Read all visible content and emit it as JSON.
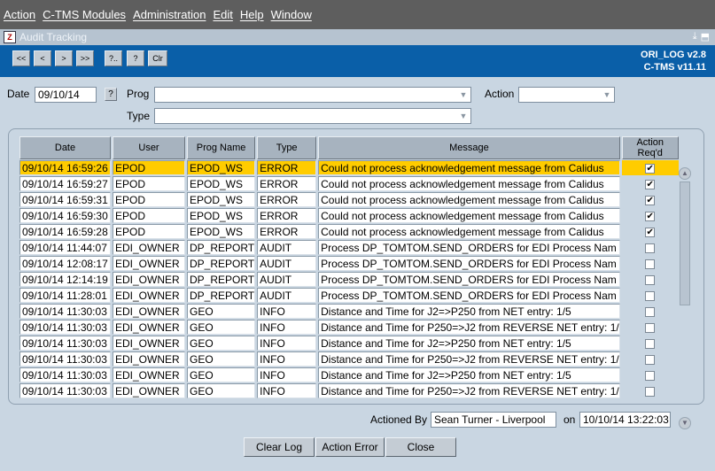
{
  "menu": [
    "Action",
    "C-TMS Modules",
    "Administration",
    "Edit",
    "Help",
    "Window"
  ],
  "window": {
    "title": "Audit Tracking",
    "controls": [
      "⤓",
      "⬒"
    ],
    "app_icon": "Z"
  },
  "toolbar": {
    "buttons": [
      "<<",
      "<",
      ">",
      ">>",
      "?..",
      "?",
      "Clr"
    ],
    "version1": "ORI_LOG v2.8",
    "version2": "C-TMS v11.11"
  },
  "filters": {
    "date_label": "Date",
    "date_value": "09/10/14",
    "help_btn": "?",
    "prog_label": "Prog",
    "prog_value": "",
    "action_label": "Action",
    "action_value": "",
    "type_label": "Type",
    "type_value": ""
  },
  "grid": {
    "columns": [
      "Date",
      "User",
      "Prog Name",
      "Type",
      "Message",
      "Action Req'd"
    ],
    "rows": [
      {
        "date": "09/10/14 16:59:26",
        "user": "EPOD",
        "prog": "EPOD_WS",
        "type": "ERROR",
        "message": "Could not process acknowledgement message from Calidus",
        "checked": true,
        "selected": true
      },
      {
        "date": "09/10/14 16:59:27",
        "user": "EPOD",
        "prog": "EPOD_WS",
        "type": "ERROR",
        "message": "Could not process acknowledgement message from Calidus",
        "checked": true
      },
      {
        "date": "09/10/14 16:59:31",
        "user": "EPOD",
        "prog": "EPOD_WS",
        "type": "ERROR",
        "message": "Could not process acknowledgement message from Calidus",
        "checked": true
      },
      {
        "date": "09/10/14 16:59:30",
        "user": "EPOD",
        "prog": "EPOD_WS",
        "type": "ERROR",
        "message": "Could not process acknowledgement message from Calidus",
        "checked": true
      },
      {
        "date": "09/10/14 16:59:28",
        "user": "EPOD",
        "prog": "EPOD_WS",
        "type": "ERROR",
        "message": "Could not process acknowledgement message from Calidus",
        "checked": true
      },
      {
        "date": "09/10/14 11:44:07",
        "user": "EDI_OWNER",
        "prog": "DP_REPORT",
        "type": "AUDIT",
        "message": "Process DP_TOMTOM.SEND_ORDERS for EDI Process Nam",
        "checked": false
      },
      {
        "date": "09/10/14 12:08:17",
        "user": "EDI_OWNER",
        "prog": "DP_REPORT",
        "type": "AUDIT",
        "message": "Process DP_TOMTOM.SEND_ORDERS for EDI Process Nam",
        "checked": false
      },
      {
        "date": "09/10/14 12:14:19",
        "user": "EDI_OWNER",
        "prog": "DP_REPORT",
        "type": "AUDIT",
        "message": "Process DP_TOMTOM.SEND_ORDERS for EDI Process Nam",
        "checked": false
      },
      {
        "date": "09/10/14 11:28:01",
        "user": "EDI_OWNER",
        "prog": "DP_REPORT",
        "type": "AUDIT",
        "message": "Process DP_TOMTOM.SEND_ORDERS for EDI Process Nam",
        "checked": false
      },
      {
        "date": "09/10/14 11:30:03",
        "user": "EDI_OWNER",
        "prog": "GEO",
        "type": "INFO",
        "message": "Distance and Time for J2=>P250 from NET entry: 1/5",
        "checked": false
      },
      {
        "date": "09/10/14 11:30:03",
        "user": "EDI_OWNER",
        "prog": "GEO",
        "type": "INFO",
        "message": "Distance and Time for P250=>J2 from REVERSE NET entry: 1/",
        "checked": false
      },
      {
        "date": "09/10/14 11:30:03",
        "user": "EDI_OWNER",
        "prog": "GEO",
        "type": "INFO",
        "message": "Distance and Time for J2=>P250 from NET entry: 1/5",
        "checked": false
      },
      {
        "date": "09/10/14 11:30:03",
        "user": "EDI_OWNER",
        "prog": "GEO",
        "type": "INFO",
        "message": "Distance and Time for P250=>J2 from REVERSE NET entry: 1/",
        "checked": false
      },
      {
        "date": "09/10/14 11:30:03",
        "user": "EDI_OWNER",
        "prog": "GEO",
        "type": "INFO",
        "message": "Distance and Time for J2=>P250 from NET entry: 1/5",
        "checked": false
      },
      {
        "date": "09/10/14 11:30:03",
        "user": "EDI_OWNER",
        "prog": "GEO",
        "type": "INFO",
        "message": "Distance and Time for P250=>J2 from REVERSE NET entry: 1/",
        "checked": false
      }
    ]
  },
  "footer": {
    "actioned_by_label": "Actioned By",
    "actioned_by_value": "Sean Turner - Liverpool",
    "on_label": "on",
    "on_value": "10/10/14 13:22:03",
    "buttons": {
      "clear_log": "Clear Log",
      "action_error": "Action Error",
      "close": "Close"
    }
  },
  "colors": {
    "selected_row": "#ffcc00",
    "toolbar": "#0a5fa8",
    "window_bg": "#c9d6e2"
  }
}
